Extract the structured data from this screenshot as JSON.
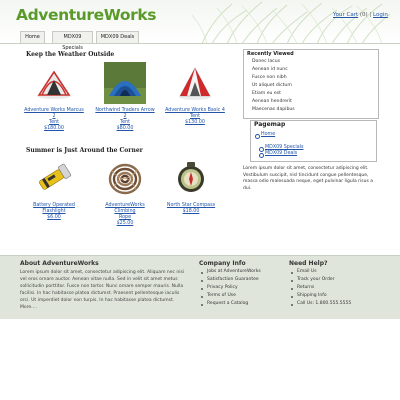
{
  "header": {
    "logo": "AdventureWorks",
    "cart_link": "Your Cart",
    "cart_count": "(0)",
    "separator": "|",
    "login_link": "Login"
  },
  "nav": {
    "tabs": [
      {
        "label": "Home"
      },
      {
        "label": "MDX09 Specials"
      },
      {
        "label": "MDX09 Deals"
      }
    ]
  },
  "main": {
    "section1_title": "Keep the Weather Outside",
    "section2_title": "Summer is Just Around the Corner",
    "products_row1": [
      {
        "name_line1": "Adventure Works Marcus 2",
        "name_line2": "Tent",
        "price": "$180.00",
        "icon": "tent-red-icon"
      },
      {
        "name_line1": "Northwind Traders Arrow 2",
        "name_line2": "Tent",
        "price": "$80.00",
        "icon": "tent-blue-icon"
      },
      {
        "name_line1": "Adventure Works Basic 4 Tent",
        "name_line2": "",
        "price": "$130.00",
        "icon": "tent-red-white-icon"
      }
    ],
    "products_row2": [
      {
        "name_line1": "Battery Operated Flashlight",
        "name_line2": "",
        "price": "$6.00",
        "icon": "flashlight-icon"
      },
      {
        "name_line1": "AdventureWorks Climbing",
        "name_line2": "Rope",
        "price": "$25.00",
        "icon": "rope-icon"
      },
      {
        "name_line1": "North Star Compass",
        "name_line2": "",
        "price": "$18.00",
        "icon": "compass-icon"
      }
    ]
  },
  "sidebar": {
    "recently_viewed_title": "Recently Viewed",
    "recently_viewed": [
      "Donec lacus",
      "Aenean id nunc",
      "Fusce non nibh",
      "Ut aliquet dictum",
      "Etiam eu est",
      "Aenean hendrerit",
      "Maecenas dapibus"
    ],
    "pagemap_title": "Pagemap",
    "pagemap_home": "Home",
    "pagemap_children": [
      "MDX09 Specials",
      "MDX09 Deals"
    ],
    "lorem": "Lorem ipsum dolor sit amet, consectetur adipiscing elit. Vestibulum suscipit, nisl tincidunt congue pellentesque, massa odio malesuada neque, eget pulvinar ligula risus a dui."
  },
  "footer": {
    "about_title": "About AdventureWorks",
    "about_text": "Lorem ipsum dolor sit amet, consectetur adipiscing elit. Aliquam nec nisi vel eros ornare auctor. Aenean vitae nulla. Sed in velit sit amet metus sollicitudin porttitor. Fusce non tortor. Nunc ornare semper mauris. Nulla facilisi. In hac habitasse platea dictumst. Praesent pellentesque iaculis orci. Ut imperdiet dolor non turpis. In hac habitasse platea dictumst. More....",
    "company_title": "Company Info",
    "company_items": [
      "Jobs at AdventureWorks",
      "Satisfaction Guarantee",
      "Privacy Policy",
      "Terms of Use",
      "Request a Catalog"
    ],
    "help_title": "Need Help?",
    "help_items": [
      "Email Us",
      "Track your Order",
      "Returns",
      "Shipping Info",
      "Call Us: 1.800.555.5555"
    ]
  },
  "colors": {
    "logo_green": "#5a9a2a",
    "link_blue": "#2255aa",
    "footer_bg": "#dfe5db"
  }
}
